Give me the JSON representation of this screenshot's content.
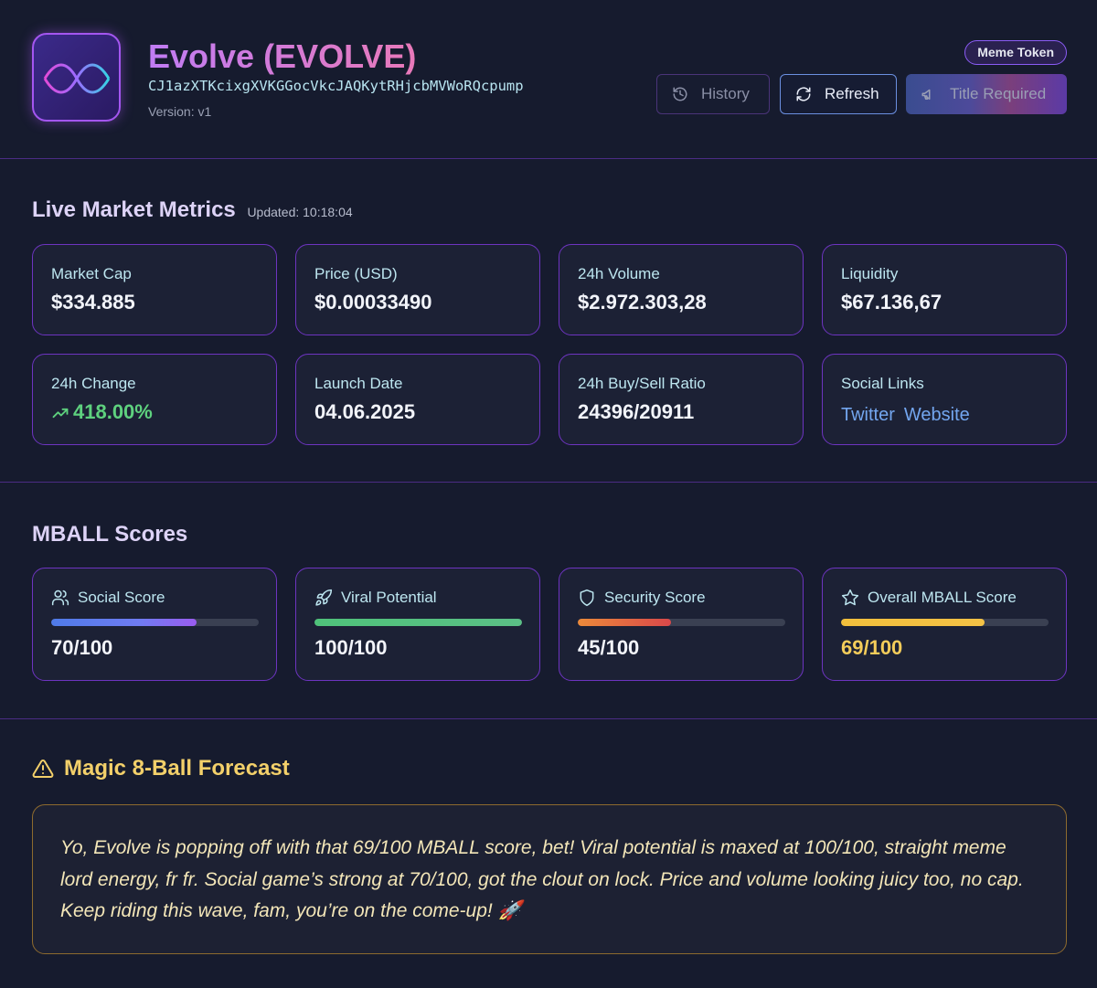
{
  "header": {
    "title": "Evolve (EVOLVE)",
    "address": "CJ1azXTKcixgXVKGGocVkcJAQKytRHjcbMVWoRQcpump",
    "version": "Version: v1",
    "badge": "Meme Token",
    "buttons": {
      "history": "History",
      "refresh": "Refresh",
      "title_required": "Title Required"
    },
    "logo_icon": "dna-icon"
  },
  "metrics": {
    "title": "Live Market Metrics",
    "updated": "Updated: 10:18:04",
    "cards": [
      {
        "label": "Market Cap",
        "value": "$334.885"
      },
      {
        "label": "Price (USD)",
        "value": "$0.00033490"
      },
      {
        "label": "24h Volume",
        "value": "$2.972.303,28"
      },
      {
        "label": "Liquidity",
        "value": "$67.136,67"
      },
      {
        "label": "24h Change",
        "value": "418.00%"
      },
      {
        "label": "Launch Date",
        "value": "04.06.2025"
      },
      {
        "label": "24h Buy/Sell Ratio",
        "value": "24396/20911"
      },
      {
        "label": "Social Links",
        "links": [
          "Twitter",
          "Website"
        ]
      }
    ],
    "positive_color": "#5ed17e"
  },
  "scores": {
    "title": "MBALL Scores",
    "items": [
      {
        "label": "Social Score",
        "value": "70/100",
        "fraction": 0.7,
        "icon": "users-icon"
      },
      {
        "label": "Viral Potential",
        "value": "100/100",
        "fraction": 1.0,
        "icon": "rocket-icon"
      },
      {
        "label": "Security Score",
        "value": "45/100",
        "fraction": 0.45,
        "icon": "shield-icon"
      },
      {
        "label": "Overall MBALL Score",
        "value": "69/100",
        "fraction": 0.69,
        "icon": "star-icon"
      }
    ],
    "colors": {
      "social": "#6f7cf2",
      "viral": "#4fc27a",
      "security": "#ec8a3a",
      "overall": "#f2bf3c"
    }
  },
  "forecast": {
    "title": "Magic 8-Ball Forecast",
    "text": "Yo, Evolve is popping off with that 69/100 MBALL score, bet! Viral potential is maxed at 100/100, straight meme lord energy, fr fr. Social game’s strong at 70/100, got the clout on lock. Price and volume looking juicy too, no cap. Keep riding this wave, fam, you’re on the come-up! 🚀"
  }
}
